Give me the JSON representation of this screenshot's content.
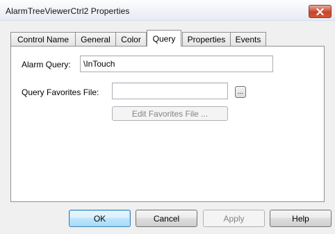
{
  "window": {
    "title": "AlarmTreeViewerCtrl2 Properties",
    "close_icon": "close-icon",
    "close_color": "#c7452b"
  },
  "tabs": [
    {
      "label": "Control Name",
      "active": false
    },
    {
      "label": "General",
      "active": false
    },
    {
      "label": "Color",
      "active": false
    },
    {
      "label": "Query",
      "active": true
    },
    {
      "label": "Properties",
      "active": false
    },
    {
      "label": "Events",
      "active": false
    }
  ],
  "query": {
    "alarm_query_label": "Alarm Query:",
    "alarm_query_value": "\\InTouch",
    "favorites_label": "Query Favorites File:",
    "favorites_value": "",
    "browse_label": "...",
    "edit_favorites_label": "Edit Favorites File ..."
  },
  "buttons": {
    "ok": "OK",
    "cancel": "Cancel",
    "apply": "Apply",
    "help": "Help"
  }
}
